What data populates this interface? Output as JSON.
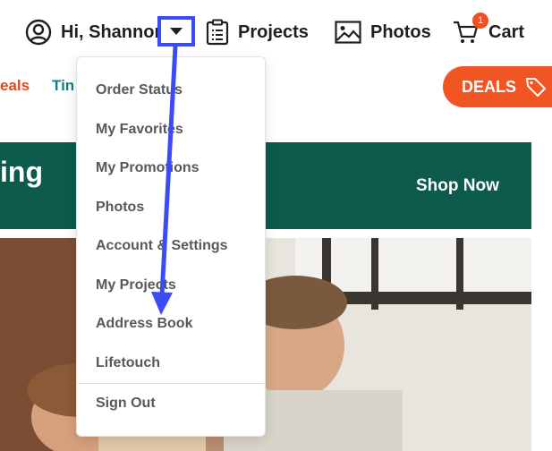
{
  "header": {
    "greeting": "Hi, Shannon",
    "projects_label": "Projects",
    "photos_label": "Photos",
    "cart_label": "Cart",
    "cart_count": "1"
  },
  "subnav": {
    "deals_text": "eals",
    "tin_text": "Tin"
  },
  "deals_button": {
    "label": "DEALS"
  },
  "banner": {
    "text": "ing",
    "cta": "Shop Now"
  },
  "menu": {
    "items": [
      "Order Status",
      "My Favorites",
      "My Promotions",
      "Photos",
      "Account & Settings",
      "My Projects",
      "Address Book",
      "Lifetouch"
    ],
    "sign_out": "Sign Out"
  },
  "colors": {
    "accent_orange": "#f05523",
    "banner_green": "#0c5b4c",
    "annotation_blue": "#3b4bf5"
  }
}
